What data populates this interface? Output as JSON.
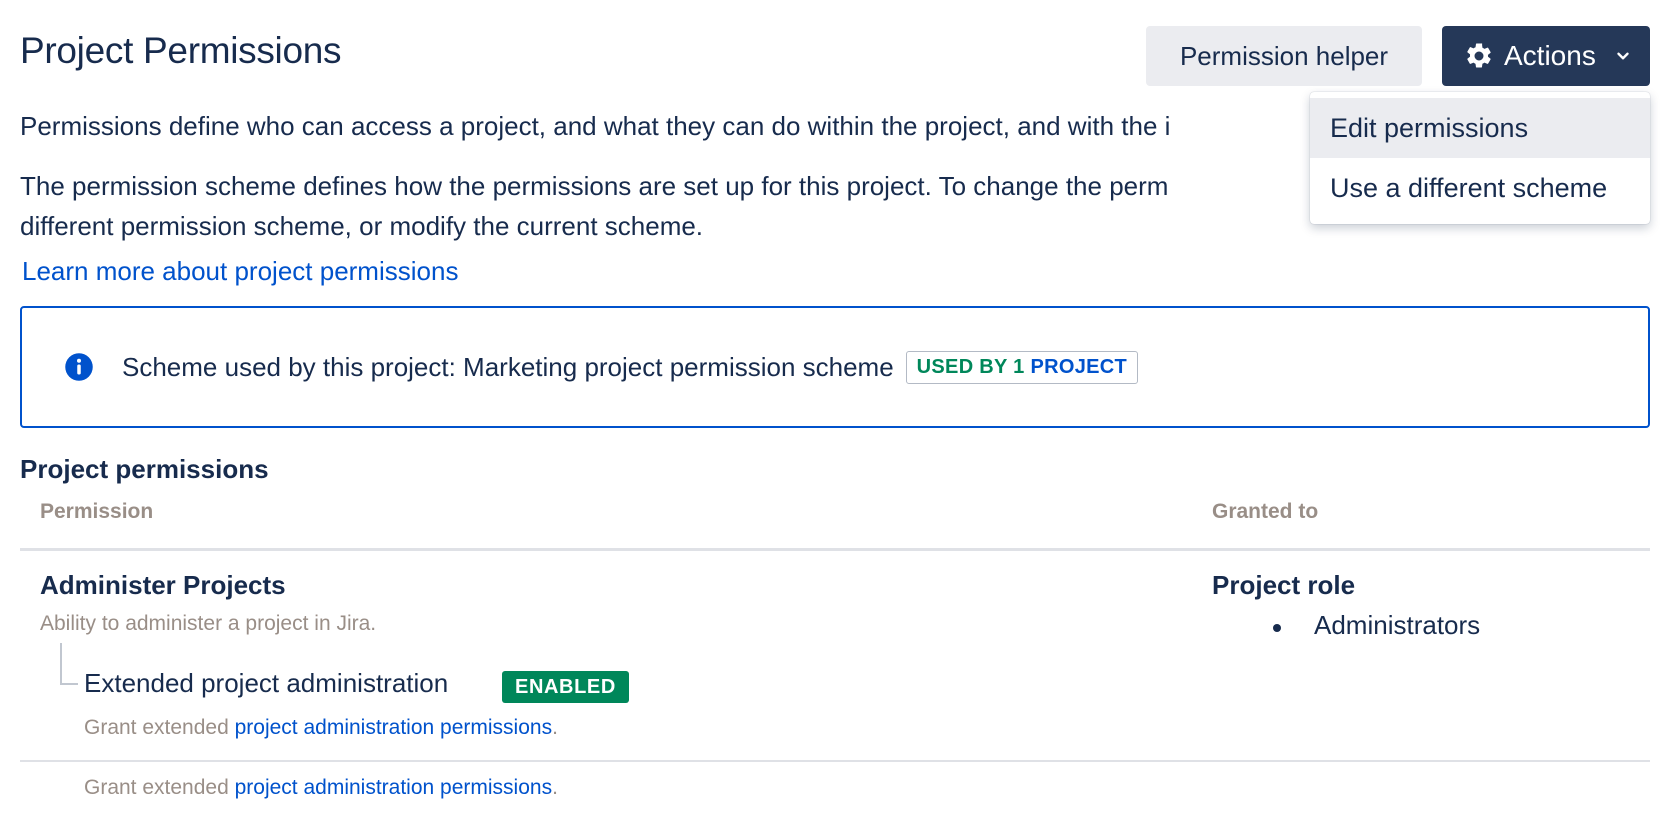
{
  "header": {
    "title": "Project Permissions",
    "helper_button": "Permission helper",
    "actions_button": "Actions"
  },
  "actions_menu": {
    "items": [
      {
        "label": "Edit permissions",
        "highlighted": true
      },
      {
        "label": "Use a different scheme",
        "highlighted": false
      }
    ]
  },
  "intro": {
    "paragraph1": "Permissions define who can access a project, and what they can do within the project, and with the i",
    "paragraph2_line1": "The permission scheme defines how the permissions are set up for this project. To change the perm",
    "paragraph2_line2": "different permission scheme, or modify the current scheme.",
    "learn_more_link": "Learn more about project permissions"
  },
  "scheme_info": {
    "icon": "info-icon",
    "text": "Scheme used by this project: Marketing project permission scheme",
    "badge_part1": "USED BY 1",
    "badge_part2": "PROJECT"
  },
  "permissions_table": {
    "section_title": "Project permissions",
    "columns": [
      "Permission",
      "Granted to"
    ],
    "rows": [
      {
        "name": "Administer Projects",
        "description": "Ability to administer a project in Jira.",
        "sub_permission": {
          "name": "Extended project administration",
          "status": "ENABLED",
          "grant_prefix": "Grant extended",
          "grant_link": "project administration permissions",
          "grant_suffix": "."
        },
        "granted_to": {
          "type": "Project role",
          "values": [
            "Administrators"
          ]
        }
      }
    ],
    "trailing_grant_prefix": "Grant extended",
    "trailing_grant_link": "project administration permissions",
    "trailing_grant_suffix": "."
  },
  "colors": {
    "primary_text": "#172b4d",
    "link": "#0052cc",
    "actions_bg": "#253858",
    "helper_bg": "#ebecf0",
    "success": "#00875a",
    "subtle_text": "#998e87"
  }
}
